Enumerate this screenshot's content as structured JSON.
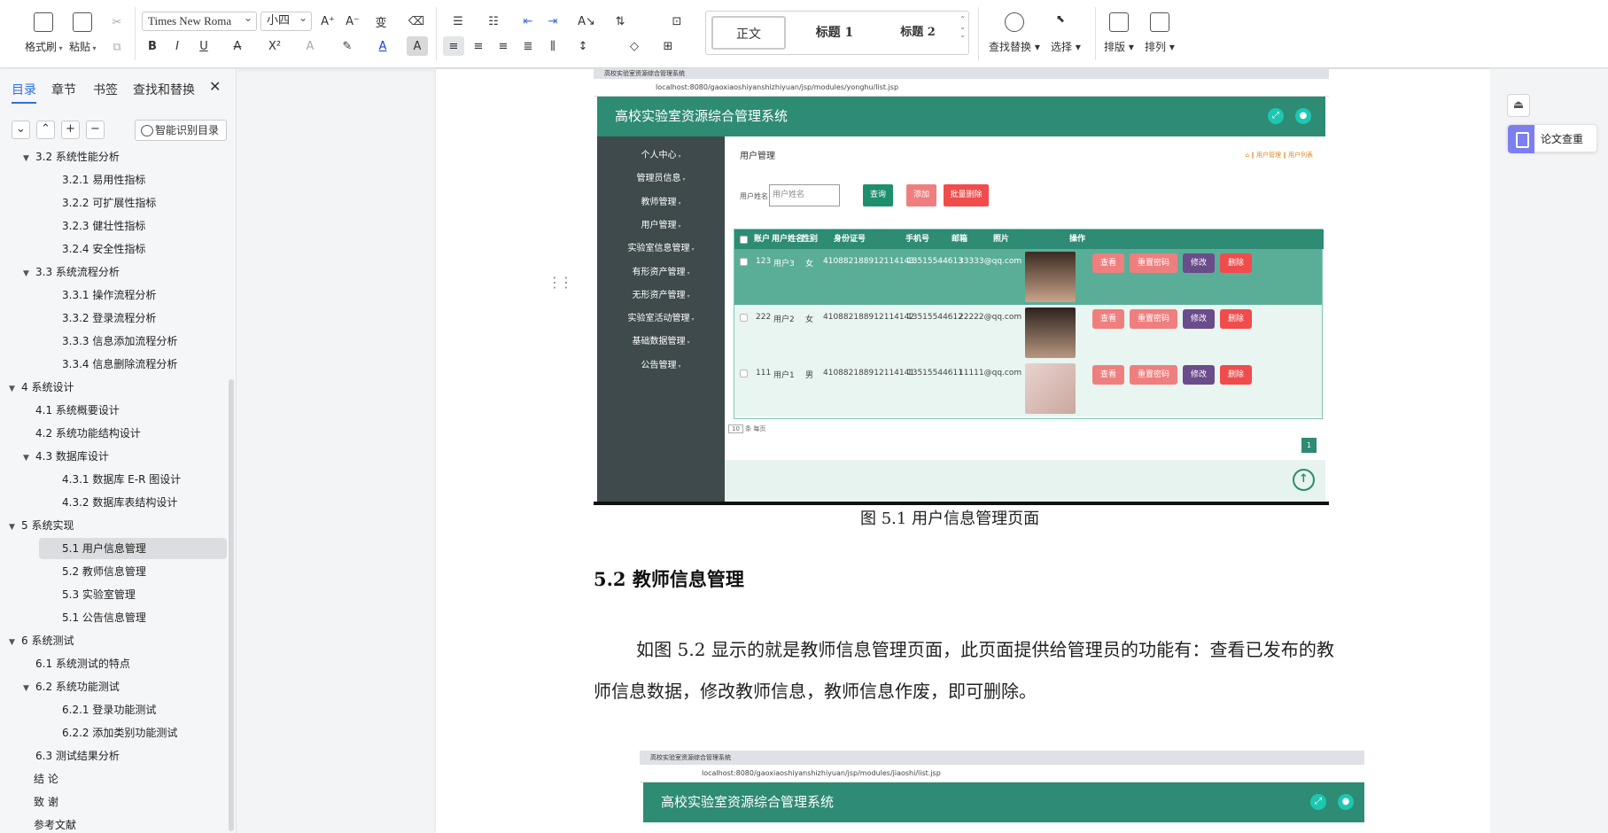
{
  "toolbar": {
    "format_painter": "格式刷",
    "paste": "粘贴",
    "font_name": "Times New Roma",
    "font_size": "小四",
    "styles": [
      "正文",
      "标题 1",
      "标题 2"
    ],
    "find_replace": "查找替换",
    "select": "选择",
    "layout": "排版",
    "arrange": "排列"
  },
  "sidebar": {
    "tabs": [
      "目录",
      "章节",
      "书签",
      "查找和替换"
    ],
    "smart_toc": "智能识别目录",
    "toc": [
      {
        "text": "3.2  系统性能分析",
        "level": 1,
        "expanded": true
      },
      {
        "text": "3.2.1  易用性指标",
        "level": 2
      },
      {
        "text": "3.2.2  可扩展性指标",
        "level": 2
      },
      {
        "text": "3.2.3  健壮性指标",
        "level": 2
      },
      {
        "text": "3.2.4  安全性指标",
        "level": 2
      },
      {
        "text": "3.3  系统流程分析",
        "level": 1,
        "expanded": true
      },
      {
        "text": "3.3.1  操作流程分析",
        "level": 2
      },
      {
        "text": "3.3.2  登录流程分析",
        "level": 2
      },
      {
        "text": "3.3.3  信息添加流程分析",
        "level": 2
      },
      {
        "text": "3.3.4  信息删除流程分析",
        "level": 2
      },
      {
        "text": "4  系统设计",
        "level": 0,
        "expanded": true
      },
      {
        "text": "4.1  系统概要设计",
        "level": 1
      },
      {
        "text": "4.2  系统功能结构设计",
        "level": 1
      },
      {
        "text": "4.3  数据库设计",
        "level": 1,
        "expanded": true
      },
      {
        "text": "4.3.1  数据库 E-R 图设计",
        "level": 2
      },
      {
        "text": "4.3.2  数据库表结构设计",
        "level": 2
      },
      {
        "text": "5  系统实现",
        "level": 0,
        "expanded": true
      },
      {
        "text": "5.1 用户信息管理",
        "level": 2,
        "current": true
      },
      {
        "text": "5.2  教师信息管理",
        "level": 2
      },
      {
        "text": "5.3 实验室管理",
        "level": 2
      },
      {
        "text": "5.1 公告信息管理",
        "level": 2
      },
      {
        "text": "6  系统测试",
        "level": 0,
        "expanded": true
      },
      {
        "text": "6.1  系统测试的特点",
        "level": 1
      },
      {
        "text": "6.2  系统功能测试",
        "level": 1,
        "expanded": true
      },
      {
        "text": "6.2.1  登录功能测试",
        "level": 2
      },
      {
        "text": "6.2.2  添加类别功能测试",
        "level": 2
      },
      {
        "text": "6.3  测试结果分析",
        "level": 1
      },
      {
        "text": "结    论",
        "level": -1
      },
      {
        "text": "致    谢",
        "level": -1
      },
      {
        "text": "参考文献",
        "level": -1
      }
    ]
  },
  "document": {
    "figure1_caption": "图 5.1  用户信息管理页面",
    "heading": "5.2  教师信息管理",
    "paragraph": "如图 5.2 显示的就是教师信息管理页面，此页面提供给管理员的功能有：查看已发布的教师信息数据，修改教师信息，教师信息作废，即可删除。"
  },
  "screenshot1": {
    "tab_title": "高校实验室资源综合管理系统",
    "url": "localhost:8080/gaoxiaoshiyanshizhiyuan/jsp/modules/yonghu/list.jsp",
    "app_title": "高校实验室资源综合管理系统",
    "menu": [
      "个人中心",
      "管理员信息",
      "教师管理",
      "用户管理",
      "实验室信息管理",
      "有形资产管理",
      "无形资产管理",
      "实验室活动管理",
      "基础数据管理",
      "公告管理"
    ],
    "page_title": "用户管理",
    "breadcrumb": "⌂ ‖ 用户管理 ‖ 用户列表",
    "search_label": "用户姓名",
    "search_placeholder": "用户姓名",
    "btn_query": "查询",
    "btn_add": "添加",
    "btn_batch_delete": "批量删除",
    "columns": [
      "账户",
      "用户姓名",
      "性别",
      "身份证号",
      "手机号",
      "邮箱",
      "照片",
      "操作"
    ],
    "rows": [
      {
        "account": "123",
        "name": "用户3",
        "gender": "女",
        "id_no": "410882188912114143",
        "phone": "13515544613",
        "email": "33333@qq.com"
      },
      {
        "account": "222",
        "name": "用户2",
        "gender": "女",
        "id_no": "410882188912114142",
        "phone": "13515544612",
        "email": "22222@qq.com"
      },
      {
        "account": "111",
        "name": "用户1",
        "gender": "男",
        "id_no": "410882188912114141",
        "phone": "13515544611",
        "email": "11111@qq.com"
      }
    ],
    "actions": [
      "查看",
      "重置密码",
      "修改",
      "删除"
    ],
    "per_page": "10",
    "per_page_suffix": "条 每页",
    "page": "1"
  },
  "screenshot2": {
    "tab_title": "高校实验室资源综合管理系统",
    "url": "localhost:8080/gaoxiaoshiyanshizhiyuan/jsp/modules/jiaoshi/list.jsp",
    "app_title": "高校实验室资源综合管理系统"
  },
  "rightbar": {
    "paper_check": "论文查重"
  },
  "colors": {
    "accent": "#2d6fe8",
    "app_green": "#2e8b74",
    "sidebar_dark": "#3e4a4c"
  }
}
